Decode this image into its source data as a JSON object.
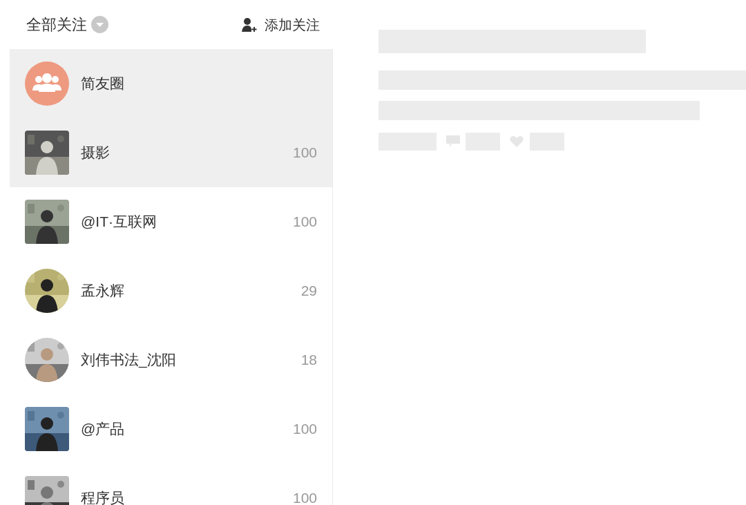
{
  "header": {
    "title": "全部关注",
    "add_button": "添加关注"
  },
  "items": [
    {
      "name": "简友圈",
      "kind": "group",
      "highlighted": true
    },
    {
      "name": "摄影",
      "count": "100",
      "kind": "square",
      "highlighted": true
    },
    {
      "name": "@IT·互联网",
      "count": "100",
      "kind": "square",
      "highlighted": false
    },
    {
      "name": "孟永辉",
      "count": "29",
      "kind": "circle",
      "highlighted": false
    },
    {
      "name": "刘伟书法_沈阳",
      "count": "18",
      "kind": "circle",
      "highlighted": false
    },
    {
      "name": "@产品",
      "count": "100",
      "kind": "square",
      "highlighted": false
    },
    {
      "name": "程序员",
      "count": "100",
      "kind": "square",
      "highlighted": false
    }
  ]
}
